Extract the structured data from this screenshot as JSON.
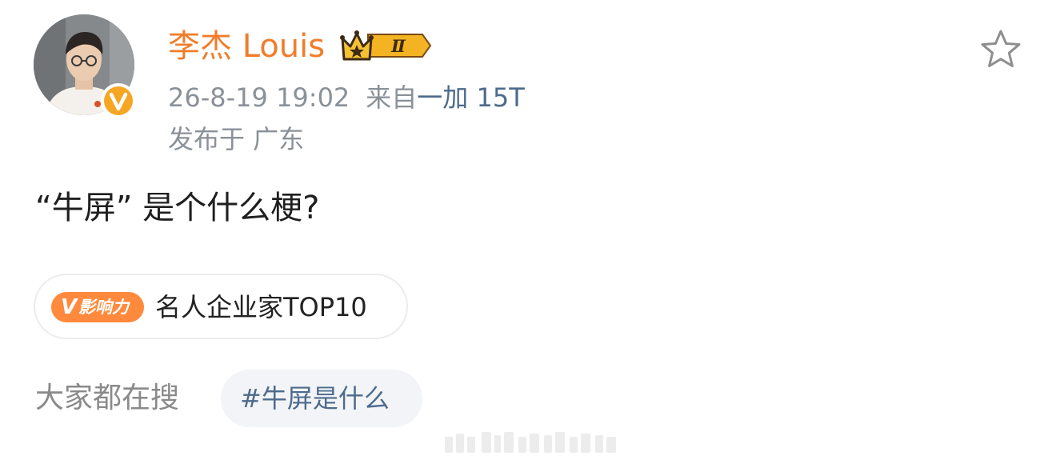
{
  "author": {
    "name": "李杰 Louis",
    "level_badge": "Ⅱ",
    "verified_mark": "V"
  },
  "meta": {
    "time": "26-8-19 19:02",
    "from_prefix": "来自",
    "device": "一加 15T",
    "location": "发布于 广东"
  },
  "post": {
    "text": "“牛屏” 是个什么梗?"
  },
  "influence": {
    "tag_v": "V",
    "tag_text": "影响力",
    "label": "名人企业家TOP10"
  },
  "search": {
    "label": "大家都在搜",
    "hashtag": "#牛屏是什么"
  },
  "icons": {
    "favorite": "star-outline-icon",
    "crown": "crown-icon",
    "verified": "verified-v-icon"
  },
  "colors": {
    "username": "#f07d2a",
    "link": "#4d6b8c",
    "muted": "#8b9198",
    "influence_tag": "#ff8a3d",
    "verified": "#f6a623"
  }
}
